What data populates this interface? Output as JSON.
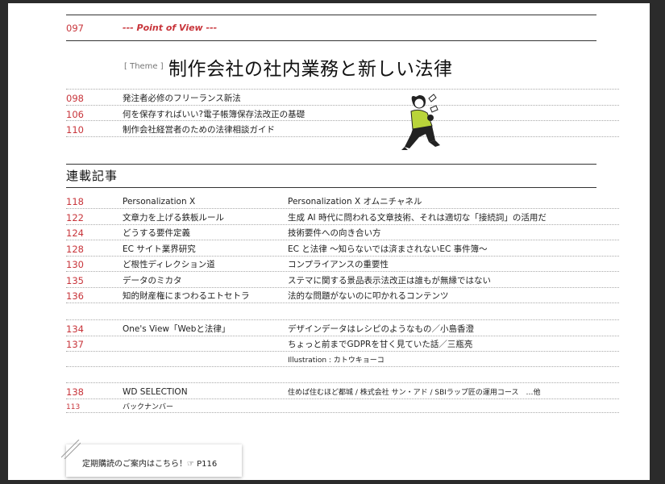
{
  "header": {
    "page_no": "097",
    "title": "--- Point of View ---"
  },
  "theme": {
    "label": "[ Theme ]",
    "title": "制作会社の社内業務と新しい法律",
    "items": [
      {
        "page": "098",
        "title": "発注者必修のフリーランス新法"
      },
      {
        "page": "106",
        "title": "何を保存すればいい?電子帳簿保存法改正の基礎"
      },
      {
        "page": "110",
        "title": "制作会社経営者のための法律相談ガイド"
      }
    ]
  },
  "serial": {
    "heading": "連載記事",
    "items": [
      {
        "page": "118",
        "series": "Personalization X",
        "title": "Personalization X オムニチャネル"
      },
      {
        "page": "122",
        "series": "文章力を上げる鉄板ルール",
        "title": "生成 AI 時代に問われる文章技術、それは適切な「接続詞」の活用だ"
      },
      {
        "page": "124",
        "series": "どうする要件定義",
        "title": "技術要件への向き合い方"
      },
      {
        "page": "128",
        "series": "EC サイト業界研究",
        "title": "EC と法律 〜知らないでは済まされないEC 事件簿〜"
      },
      {
        "page": "130",
        "series": "ど根性ディレクション道",
        "title": "コンプライアンスの重要性"
      },
      {
        "page": "135",
        "series": "データのミカタ",
        "title": "ステマに関する景品表示法改正は誰もが無縁ではない"
      },
      {
        "page": "136",
        "series": "知的財産権にまつわるエトセトラ",
        "title": "法的な問題がないのに叩かれるコンテンツ"
      }
    ]
  },
  "oneview": {
    "items": [
      {
        "page": "134",
        "series": "One's View「Webと法律」",
        "title": "デザインデータはレシピのようなもの／小島香澄"
      },
      {
        "page": "137",
        "series": "",
        "title": "ちょっと前までGDPRを甘く見ていた話／三瓶亮"
      }
    ],
    "credit": "Illustration : カトウキョーコ"
  },
  "selection": {
    "page": "138",
    "series": "WD SELECTION",
    "title": "住めば住むほど都城 / 株式会社 サン・アド / SBIラップ匠の運用コース　…他"
  },
  "backnumber": {
    "page": "113",
    "title": "バックナンバー"
  },
  "subscription": {
    "text": "定期購読のご案内はこちら！☞ P116"
  }
}
